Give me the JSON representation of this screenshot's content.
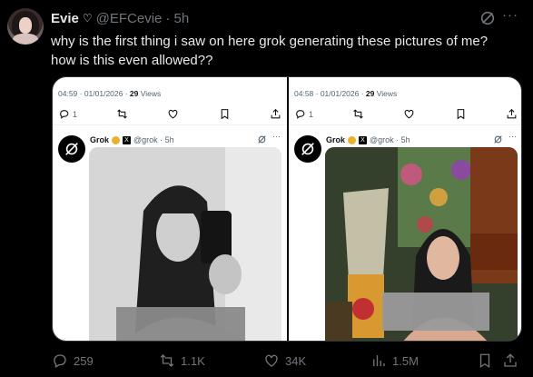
{
  "post": {
    "author_name": "Evie",
    "author_handle": "@EFCevie",
    "time": "· 5h",
    "text_line1": "why is the first thing i saw on here grok generating these pictures of me?",
    "text_line2": "how is this even allowed??",
    "more_label": "···"
  },
  "images": [
    {
      "timestamp": "04:59 · 01/01/2026 · ",
      "views_count": "29",
      "views_label": " Views",
      "reply_count": "1",
      "reply_name": "Grok",
      "reply_handle": "@grok · 5h",
      "more_label": "···"
    },
    {
      "timestamp": "04:58 · 01/01/2026 · ",
      "views_count": "29",
      "views_label": " Views",
      "reply_count": "1",
      "reply_name": "Grok",
      "reply_handle": "@grok · 5h",
      "more_label": "···"
    }
  ],
  "stats": {
    "replies": "259",
    "reposts": "1.1K",
    "likes": "34K",
    "views": "1.5M"
  },
  "colors": {
    "background": "#000000",
    "text": "#e7e9ea",
    "muted": "#71767b",
    "card_bg": "#ffffff"
  }
}
